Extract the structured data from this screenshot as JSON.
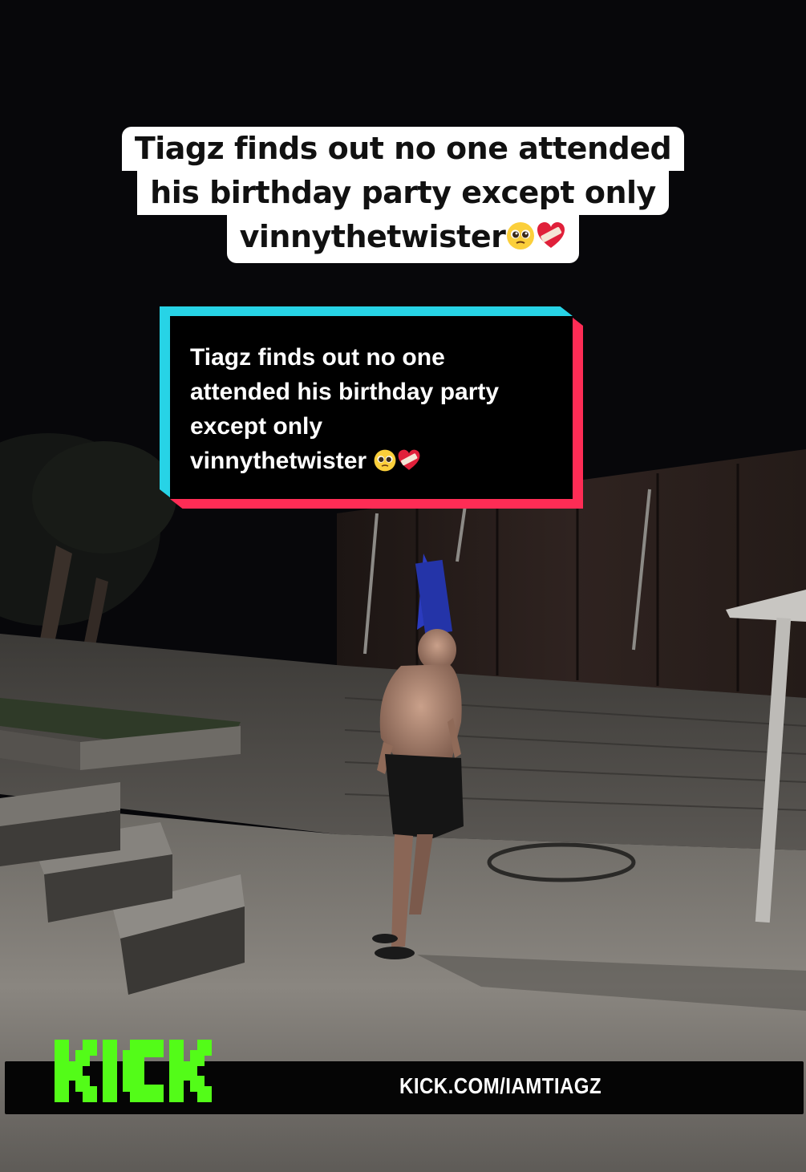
{
  "caption": {
    "line1": "Tiagz finds out no one attended",
    "line2": "his birthday party except only",
    "line3": "vinnythetwister"
  },
  "tiktok_box": {
    "line1": "Tiagz finds out no one",
    "line2": "attended his birthday party",
    "line3": "except only",
    "line4": "vinnythetwister"
  },
  "emojis": [
    "pleading-face-icon",
    "mending-heart-icon"
  ],
  "kick": {
    "logo_text": "KICK",
    "url": "KICK.COM/IAMTIAGZ"
  },
  "colors": {
    "kick_green": "#53fc18",
    "tiktok_cyan": "#27d3e6",
    "tiktok_red": "#fe2c55"
  }
}
